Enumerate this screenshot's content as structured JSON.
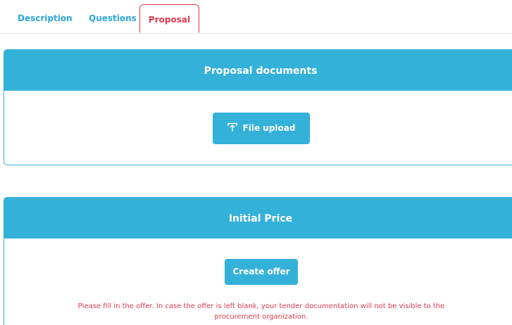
{
  "tabs": [
    {
      "label": "Description"
    },
    {
      "label": "Questions"
    },
    {
      "label": "Proposal"
    }
  ],
  "proposal_documents": {
    "title": "Proposal documents",
    "upload_label": "File upload",
    "upload_icon": "upload-icon"
  },
  "initial_price": {
    "title": "Initial Price",
    "create_offer_label": "Create offer",
    "warning": "Please fill in the offer. In case the offer is left blank, your tender documentation will not be visible to the procurement organization."
  },
  "colors": {
    "accent": "#34b1d9",
    "tab_text": "#2aa7d9",
    "active_tab": "#e03a4e",
    "warning": "#e03a4e"
  }
}
